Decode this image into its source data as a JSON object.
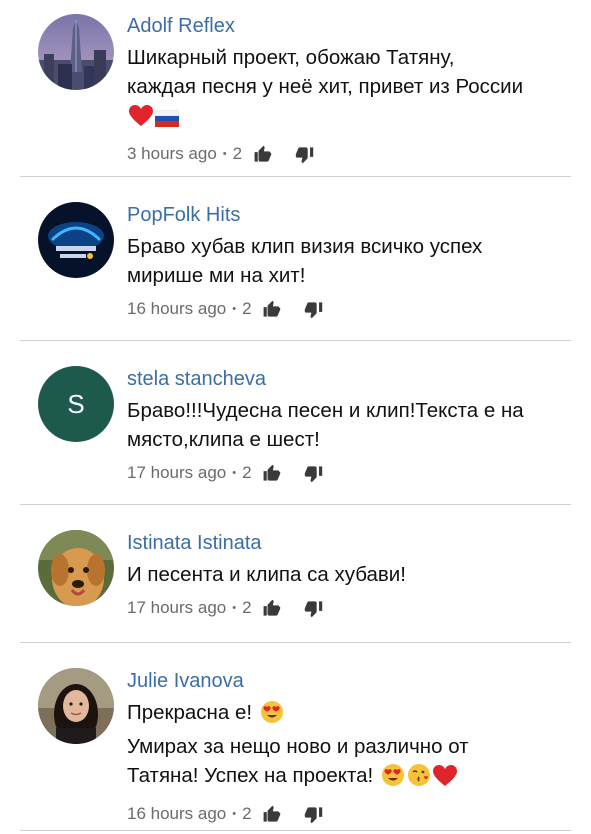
{
  "comments": [
    {
      "author": "Adolf Reflex",
      "lines": [
        "Шикарный проект, обожаю Татяну,",
        "каждая песня у неё хит, привет из России"
      ],
      "emoji": [
        "red-heart",
        "flag-russia"
      ],
      "time": "3 hours ago",
      "likes": "2",
      "avatar": "building-photo"
    },
    {
      "author": "PopFolk Hits",
      "lines": [
        "Браво хубав клип визия всичко успех",
        "мирише ми на хит!"
      ],
      "time": "16 hours ago",
      "likes": "2",
      "avatar": "channel-logo"
    },
    {
      "author": "stela stancheva",
      "lines": [
        "Браво!!!Чудесна песен и клип!Текста е на",
        "място,клипа е шест!"
      ],
      "time": "17 hours ago",
      "likes": "2",
      "avatar_letter": "S",
      "avatar_color": "#1e5a4c"
    },
    {
      "author": "Istinata Istinata",
      "lines": [
        "И песента и клипа са хубави!"
      ],
      "time": "17 hours ago",
      "likes": "2",
      "avatar": "dog-photo"
    },
    {
      "author": "Julie Ivanova",
      "lines": [
        "Прекрасна е!",
        "Умирах за нещо ново и различно от",
        "Татяна! Успех на проекта!"
      ],
      "emoji": [
        "heart-eyes-face",
        "heart-eyes-face",
        "kissing-face",
        "red-heart"
      ],
      "time": "16 hours ago",
      "likes": "2",
      "avatar": "woman-photo"
    }
  ],
  "colors": {
    "author": "#3a6ea5",
    "meta": "#6b6b6b",
    "divider": "#cfcfcf"
  }
}
